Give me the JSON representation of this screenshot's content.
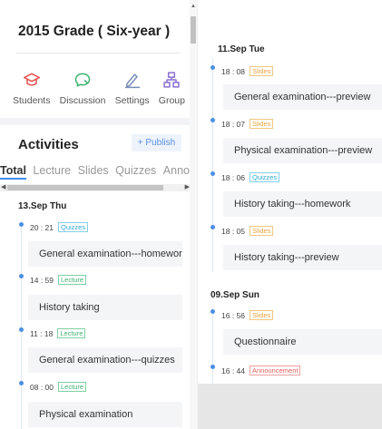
{
  "course": {
    "title": "2015 Grade ( Six-year )"
  },
  "tools": [
    {
      "label": "Students",
      "icon": "graduation-cap-icon",
      "color": "#e84b4b"
    },
    {
      "label": "Discussion",
      "icon": "chat-bubble-icon",
      "color": "#3cb371"
    },
    {
      "label": "Settings",
      "icon": "pen-icon",
      "color": "#7a8fb8"
    },
    {
      "label": "Group",
      "icon": "org-chart-icon",
      "color": "#8a6fd1"
    }
  ],
  "activities": {
    "heading": "Activities",
    "publish_label": "+ Publish",
    "tabs": [
      "Total",
      "Lecture",
      "Slides",
      "Quizzes",
      "Announce"
    ],
    "active_tab": "Total"
  },
  "left_timeline": {
    "date": "13.Sep   Thu",
    "items": [
      {
        "time": "20 : 21",
        "type": "Quizzes",
        "title": "General examination---homework"
      },
      {
        "time": "14 : 59",
        "type": "Lecture",
        "title": "History taking"
      },
      {
        "time": "11 : 18",
        "type": "Lecture",
        "title": "General examination---quizzes"
      },
      {
        "time": "08 : 00",
        "type": "Lecture",
        "title": "Physical examination"
      }
    ]
  },
  "right_timeline": {
    "groups": [
      {
        "date": "11.Sep   Tue",
        "items": [
          {
            "time": "18 : 08",
            "type": "Slides",
            "title": "General examination---preview"
          },
          {
            "time": "18 : 07",
            "type": "Slides",
            "title": "Physical examination---preview"
          },
          {
            "time": "18 : 06",
            "type": "Quizzes",
            "title": "History taking---homework"
          },
          {
            "time": "18 : 05",
            "type": "Slides",
            "title": "History taking---preview"
          }
        ]
      },
      {
        "date": "09.Sep   Sun",
        "items": [
          {
            "time": "16 : 56",
            "type": "Slides",
            "title": "Questionnaire"
          },
          {
            "time": "16 : 44",
            "type": "Announcement",
            "title": ""
          }
        ]
      }
    ]
  },
  "colors": {
    "accent": "#3c8ef0",
    "lecture": "#3cb371",
    "quizzes": "#2fa9d4",
    "slides": "#e8a33a",
    "announcement": "#e25b5b"
  }
}
